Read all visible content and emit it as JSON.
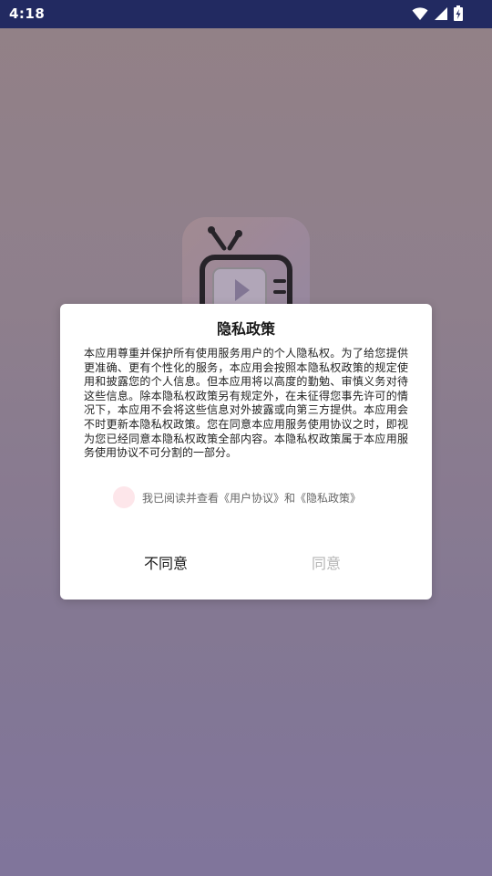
{
  "status_bar": {
    "time": "4:18",
    "icons": [
      "wifi-icon",
      "signal-icon",
      "battery-charging-icon"
    ]
  },
  "splash": {
    "logo_icon": "tv-play-icon"
  },
  "dialog": {
    "title": "隐私政策",
    "body": "本应用尊重并保护所有使用服务用户的个人隐私权。为了给您提供更准确、更有个性化的服务，本应用会按照本隐私权政策的规定使用和披露您的个人信息。但本应用将以高度的勤勉、审慎义务对待这些信息。除本隐私权政策另有规定外，在未征得您事先许可的情况下，本应用不会将这些信息对外披露或向第三方提供。本应用会不时更新本隐私权政策。您在同意本应用服务使用协议之时，即视为您已经同意本隐私权政策全部内容。本隐私权政策属于本应用服务使用协议不可分割的一部分。",
    "agree_prefix": "我已阅读并查看",
    "user_agreement_link": "《用户协议》",
    "and_text": "和",
    "privacy_policy_link": "《隐私政策》",
    "disagree_label": "不同意",
    "agree_label": "同意"
  },
  "colors": {
    "status_bar_bg": "#222a61",
    "checkbox_bg": "#fde6ea",
    "agree_disabled": "#b5b5b5"
  }
}
